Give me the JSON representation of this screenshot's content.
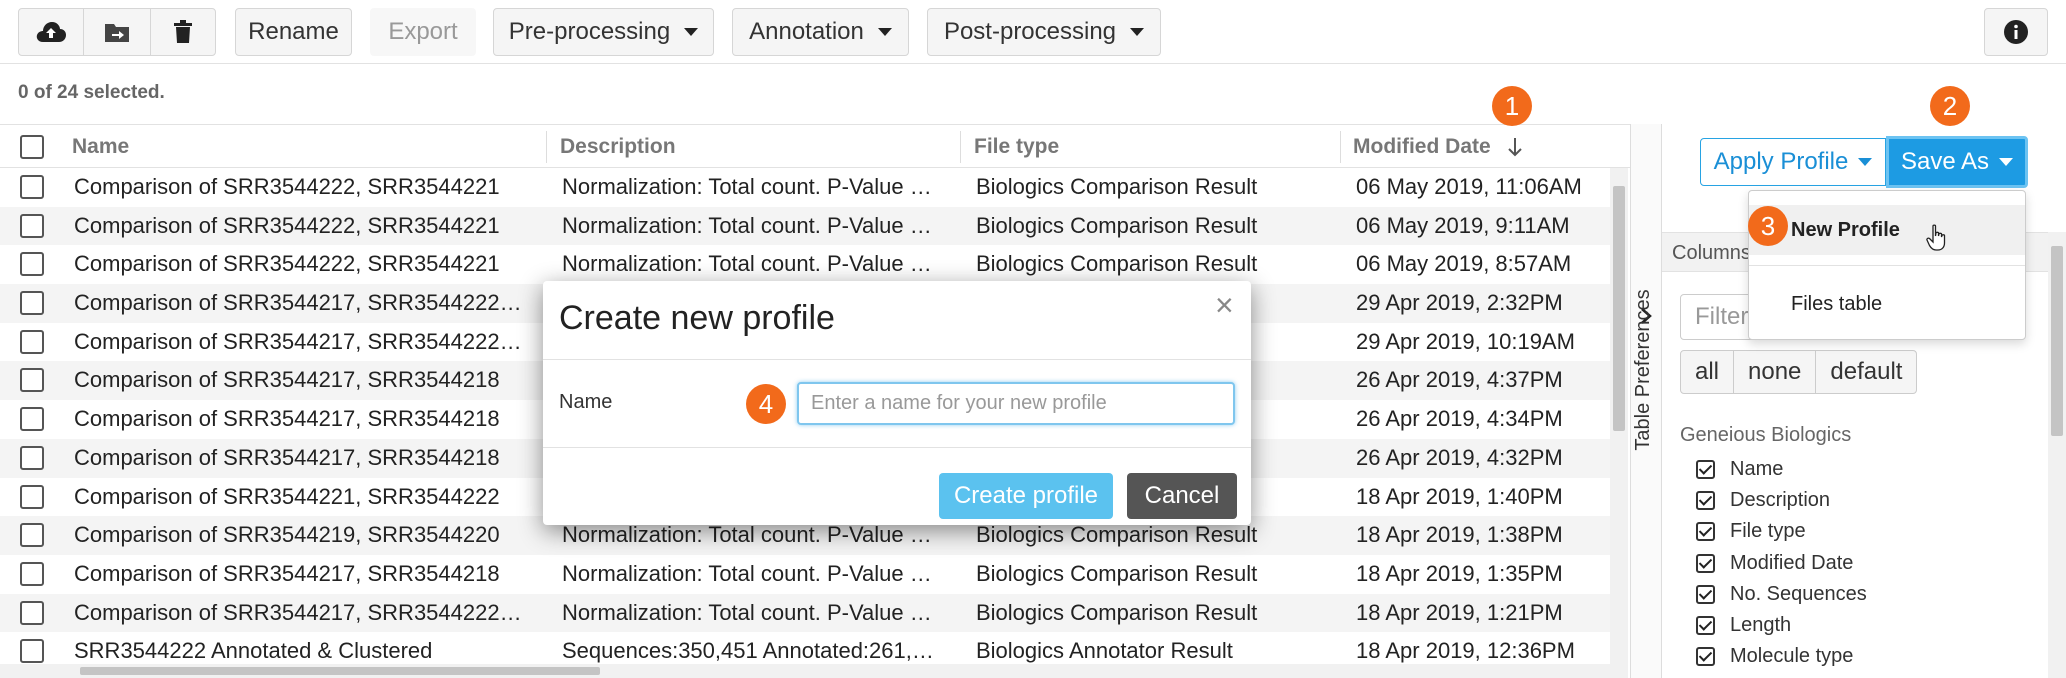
{
  "toolbar": {
    "rename_label": "Rename",
    "export_label": "Export",
    "preprocessing_label": "Pre-processing",
    "annotation_label": "Annotation",
    "postprocessing_label": "Post-processing"
  },
  "selection": {
    "count_text": "0 of 24 selected."
  },
  "table": {
    "columns": [
      "Name",
      "Description",
      "File type",
      "Modified Date"
    ],
    "rows": [
      [
        "Comparison of SRR3544222, SRR3544221",
        "Normalization: Total count. P-Value …",
        "Biologics Comparison Result",
        "06 May 2019, 11:06AM"
      ],
      [
        "Comparison of SRR3544222, SRR3544221",
        "Normalization: Total count. P-Value …",
        "Biologics Comparison Result",
        "06 May 2019, 9:11AM"
      ],
      [
        "Comparison of SRR3544222, SRR3544221",
        "Normalization: Total count. P-Value …",
        "Biologics Comparison Result",
        "06 May 2019, 8:57AM"
      ],
      [
        "Comparison of SRR3544217, SRR3544222…",
        "",
        "ult",
        "29 Apr 2019, 2:32PM"
      ],
      [
        "Comparison of SRR3544217, SRR3544222…",
        "",
        "ult",
        "29 Apr 2019, 10:19AM"
      ],
      [
        "Comparison of SRR3544217, SRR3544218",
        "",
        "ult",
        "26 Apr 2019, 4:37PM"
      ],
      [
        "Comparison of SRR3544217, SRR3544218",
        "",
        "ult",
        "26 Apr 2019, 4:34PM"
      ],
      [
        "Comparison of SRR3544217, SRR3544218",
        "",
        "ult",
        "26 Apr 2019, 4:32PM"
      ],
      [
        "Comparison of SRR3544221, SRR3544222",
        "",
        "ult",
        "18 Apr 2019, 1:40PM"
      ],
      [
        "Comparison of SRR3544219, SRR3544220",
        "Normalization: Total count. P-Value …",
        "Biologics Comparison Result",
        "18 Apr 2019, 1:38PM"
      ],
      [
        "Comparison of SRR3544217, SRR3544218",
        "Normalization: Total count. P-Value …",
        "Biologics Comparison Result",
        "18 Apr 2019, 1:35PM"
      ],
      [
        "Comparison of SRR3544217, SRR3544222…",
        "Normalization: Total count. P-Value …",
        "Biologics Comparison Result",
        "18 Apr 2019, 1:21PM"
      ],
      [
        "SRR3544222 Annotated & Clustered",
        "Sequences:350,451 Annotated:261,…",
        "Biologics Annotator Result",
        "18 Apr 2019, 12:36PM"
      ]
    ]
  },
  "right_panel": {
    "tab_label": "Table Preferences",
    "apply_profile_label": "Apply Profile",
    "save_as_label": "Save As",
    "columns_header": "Columns",
    "filter_placeholder": "Filter",
    "presets": [
      "all",
      "none",
      "default"
    ],
    "section_title": "Geneious Biologics",
    "column_items": [
      "Name",
      "Description",
      "File type",
      "Modified Date",
      "No. Sequences",
      "Length",
      "Molecule type"
    ]
  },
  "dropdown": {
    "items": [
      "New Profile",
      "Files table"
    ]
  },
  "modal": {
    "title": "Create new profile",
    "close_glyph": "×",
    "name_label": "Name",
    "name_placeholder": "Enter a name for your new profile",
    "name_value": "",
    "create_label": "Create profile",
    "cancel_label": "Cancel"
  },
  "badges": [
    "1",
    "2",
    "3",
    "4"
  ],
  "colors": {
    "accent": "#1d9be3",
    "badge": "#f26a1b",
    "create_button": "#5bc2ef",
    "cancel_button": "#555555"
  }
}
